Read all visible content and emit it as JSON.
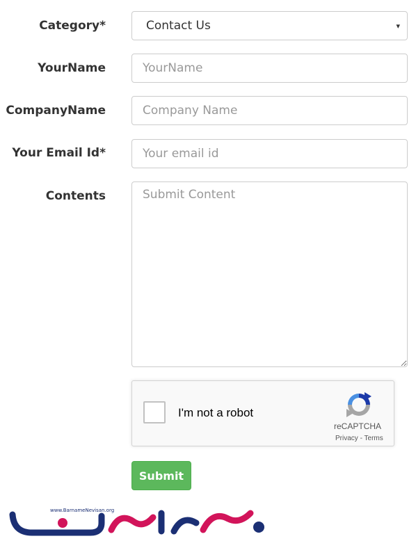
{
  "form": {
    "category": {
      "label": "Category*",
      "value": "Contact Us"
    },
    "your_name": {
      "label": "YourName",
      "placeholder": "YourName"
    },
    "company_name": {
      "label": "CompanyName",
      "placeholder": "Company Name"
    },
    "email": {
      "label": "Your Email Id*",
      "placeholder": "Your email id"
    },
    "contents": {
      "label": "Contents",
      "placeholder": "Submit Content"
    },
    "captcha": {
      "text": "I'm not a robot",
      "brand": "reCAPTCHA",
      "privacy": "Privacy",
      "separator": " - ",
      "terms": "Terms"
    },
    "submit_label": "Submit"
  },
  "logo": {
    "url_text": "www.BarnameNevisan.org",
    "name": "برنامه نویسان"
  },
  "colors": {
    "submit": "#5cb85c",
    "logo_blue": "#1b2f74",
    "logo_pink": "#d2145a"
  },
  "icons": {
    "select_caret": "▾",
    "captcha_logo": "recaptcha-icon"
  }
}
